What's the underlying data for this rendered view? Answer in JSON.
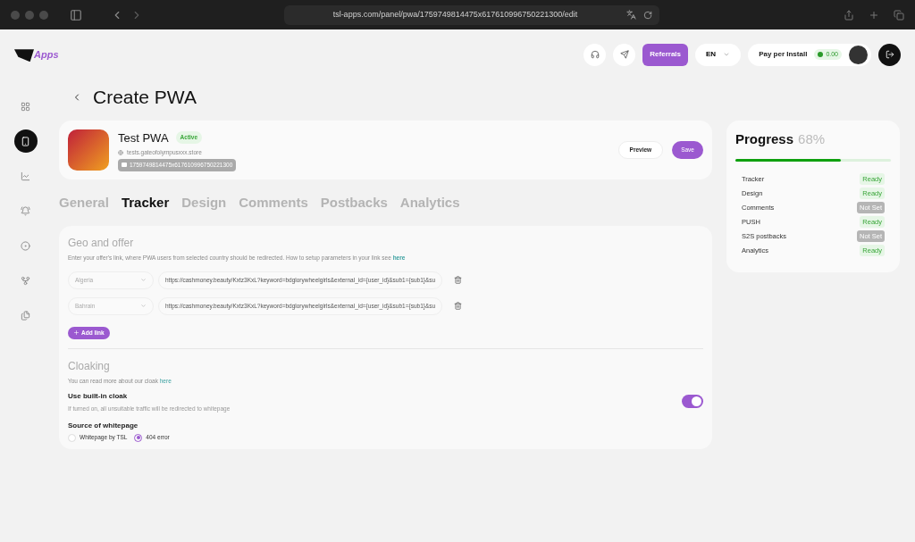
{
  "browser": {
    "url": "tsl-apps.com/panel/pwa/1759749814475x617610996750221300/edit"
  },
  "header": {
    "logo_text": "Apps",
    "referrals": "Referrals",
    "language": "EN",
    "plan": "Pay per Install",
    "balance": "0.00"
  },
  "sidebar": {
    "items": [
      {
        "selected": false
      },
      {
        "selected": true
      },
      {
        "selected": false
      },
      {
        "selected": false
      },
      {
        "selected": false
      },
      {
        "selected": false
      },
      {
        "selected": false
      }
    ]
  },
  "page_title": "Create PWA",
  "app": {
    "name": "Test PWA",
    "status": "Active",
    "domain": "tests.gateofolympusxxx.store",
    "id": "1759749814475x617610996750221300",
    "preview": "Preview",
    "save": "Save"
  },
  "tabs": [
    {
      "label": "General",
      "selected": false
    },
    {
      "label": "Tracker",
      "selected": true
    },
    {
      "label": "Design",
      "selected": false
    },
    {
      "label": "Comments",
      "selected": false
    },
    {
      "label": "Postbacks",
      "selected": false
    },
    {
      "label": "Analytics",
      "selected": false
    }
  ],
  "geo": {
    "title": "Geo and offer",
    "description": "Enter your offer's link, where PWA users from selected country should be redirected. How to setup parameters in your link see",
    "link": "here",
    "rows": [
      {
        "country": "Algeria",
        "url": "https://cashmoney.beauty/Kxtz3KxL?keyword=bdglorywheelgirls&external_id={user_id}&sub1={sub1}&su"
      },
      {
        "country": "Bahrain",
        "url": "https://cashmoney.beauty/Kxtz3KxL?keyword=bdglorywheelgirls&external_id={user_id}&sub1={sub1}&su"
      }
    ],
    "add_link": "Add link"
  },
  "cloaking": {
    "title": "Cloaking",
    "description": "You can read more about our cloak",
    "link": "here",
    "toggle_label": "Use built-in cloak",
    "toggle_hint": "If turned on, all unsuitable traffic will be redirected to whitepage",
    "on": true,
    "source_label": "Source of whitepage",
    "options": [
      {
        "label": "Whitepage by TSL",
        "selected": false
      },
      {
        "label": "404 error",
        "selected": true
      }
    ]
  },
  "progress": {
    "title": "Progress",
    "percent": "68%",
    "level": 0.68,
    "items": [
      {
        "name": "Tracker",
        "kind": "ready",
        "status": "Ready"
      },
      {
        "name": "Design",
        "kind": "ready",
        "status": "Ready"
      },
      {
        "name": "Comments",
        "kind": "not_set",
        "status": "Not Set"
      },
      {
        "name": "PUSH",
        "kind": "ready",
        "status": "Ready"
      },
      {
        "name": "S2S postbacks",
        "kind": "not_set",
        "status": "Not Set"
      },
      {
        "name": "Analytics",
        "kind": "ready",
        "status": "Ready"
      }
    ]
  }
}
